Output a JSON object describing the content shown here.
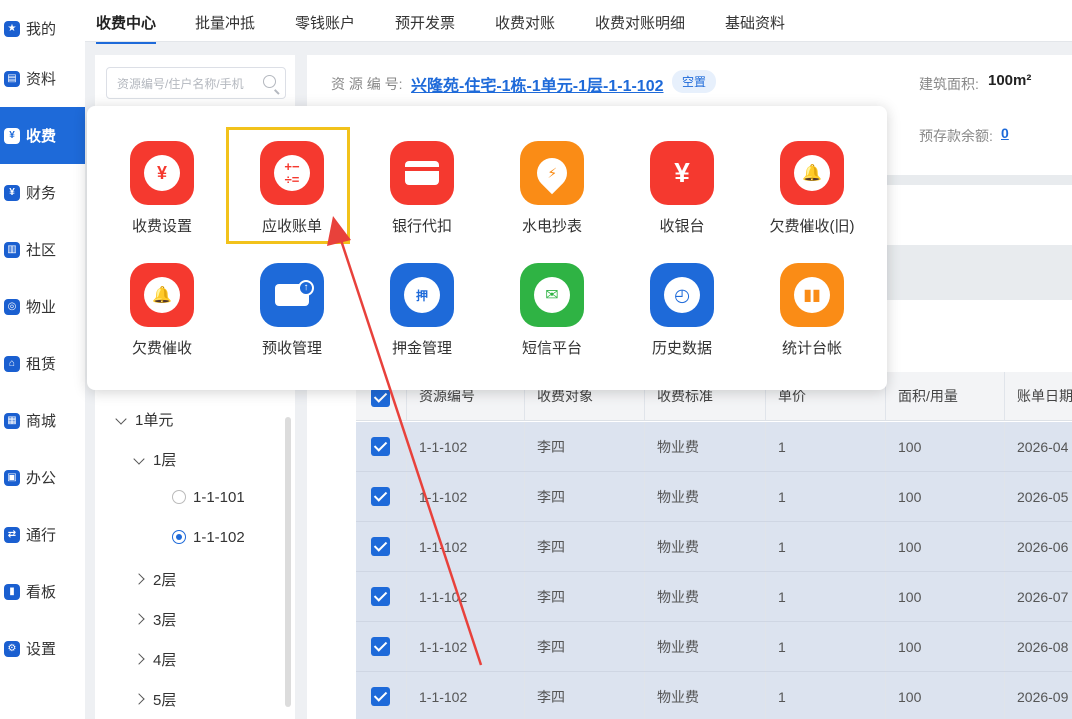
{
  "nav": {
    "items": [
      {
        "label": "我的",
        "icon": "star-icon"
      },
      {
        "label": "资料",
        "icon": "id-card-icon"
      },
      {
        "label": "收费",
        "icon": "money-bag-icon",
        "active": true
      },
      {
        "label": "财务",
        "icon": "shield-yen-icon"
      },
      {
        "label": "社区",
        "icon": "building-icon"
      },
      {
        "label": "物业",
        "icon": "shield-icon"
      },
      {
        "label": "租赁",
        "icon": "house-icon"
      },
      {
        "label": "商城",
        "icon": "shop-icon"
      },
      {
        "label": "办公",
        "icon": "briefcase-icon"
      },
      {
        "label": "通行",
        "icon": "transfer-icon"
      },
      {
        "label": "看板",
        "icon": "dashboard-icon"
      },
      {
        "label": "设置",
        "icon": "gear-icon"
      }
    ]
  },
  "tabs": [
    "收费中心",
    "批量冲抵",
    "零钱账户",
    "预开发票",
    "收费对账",
    "收费对账明细",
    "基础资料"
  ],
  "tree": {
    "search_placeholder": "资源编号/住户名称/手机",
    "unit": "1单元",
    "floor1": "1层",
    "rooms": [
      "1-1-101",
      "1-1-102"
    ],
    "selected_room": "1-1-102",
    "floors": [
      "2层",
      "3层",
      "4层",
      "5层"
    ]
  },
  "info": {
    "resource_label": "资 源 编 号:",
    "resource_value": "兴隆苑-住宅-1栋-1单元-1层-1-1-102",
    "status_badge": "空置",
    "area_label": "建筑面积:",
    "area_value": "100m²",
    "deposit_label": "预存款余额:",
    "deposit_value": "0"
  },
  "table": {
    "headers": [
      "资源编号",
      "收费对象",
      "收费标准",
      "单价",
      "面积/用量",
      "账单日期"
    ],
    "rows": [
      [
        "1-1-102",
        "李四",
        "物业费",
        "1",
        "100",
        "2026-04"
      ],
      [
        "1-1-102",
        "李四",
        "物业费",
        "1",
        "100",
        "2026-05"
      ],
      [
        "1-1-102",
        "李四",
        "物业费",
        "1",
        "100",
        "2026-06"
      ],
      [
        "1-1-102",
        "李四",
        "物业费",
        "1",
        "100",
        "2026-07"
      ],
      [
        "1-1-102",
        "李四",
        "物业费",
        "1",
        "100",
        "2026-08"
      ],
      [
        "1-1-102",
        "李四",
        "物业费",
        "1",
        "100",
        "2026-09"
      ]
    ]
  },
  "menu": {
    "apps": [
      {
        "label": "收费设置",
        "icon": "yen-coins-icon",
        "color": "#f5392f"
      },
      {
        "label": "应收账单",
        "icon": "calculator-icon",
        "color": "#f5392f",
        "highlighted": true
      },
      {
        "label": "银行代扣",
        "icon": "bank-card-icon",
        "color": "#f5392f"
      },
      {
        "label": "水电抄表",
        "icon": "water-drop-icon",
        "color": "#fa8c16"
      },
      {
        "label": "收银台",
        "icon": "yen-icon",
        "color": "#f5392f"
      },
      {
        "label": "欠费催收(旧)",
        "icon": "alarm-bell-icon",
        "color": "#f5392f"
      },
      {
        "label": "欠费催收",
        "icon": "alarm-bell-icon",
        "color": "#f5392f"
      },
      {
        "label": "预收管理",
        "icon": "card-upload-icon",
        "color": "#1e6ad9"
      },
      {
        "label": "押金管理",
        "icon": "deposit-bag-icon",
        "color": "#1e6ad9"
      },
      {
        "label": "短信平台",
        "icon": "mail-icon",
        "color": "#2fb344"
      },
      {
        "label": "历史数据",
        "icon": "clock-icon",
        "color": "#1e6ad9"
      },
      {
        "label": "统计台帐",
        "icon": "bar-chart-icon",
        "color": "#fa8c16"
      }
    ]
  },
  "colors": {
    "accent": "#1e6ad9",
    "highlight_box": "#f2c21b",
    "arrow": "#e8413b"
  }
}
